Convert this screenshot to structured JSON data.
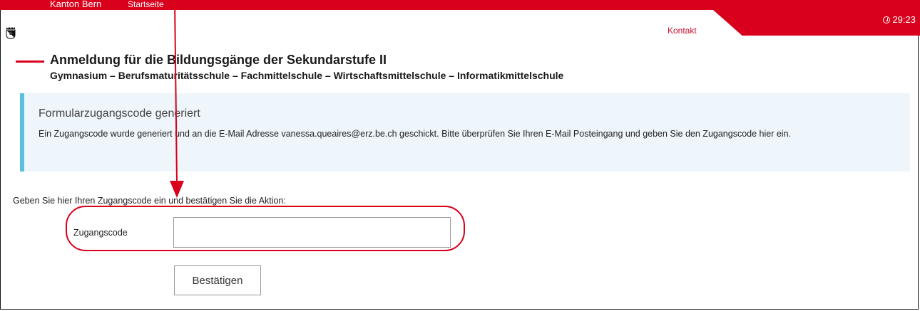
{
  "topbar": {
    "kanton": "Kanton Bern",
    "startseite": "Startseite"
  },
  "timer": "29:23",
  "kontakt": "Kontakt",
  "heading": {
    "title": "Anmeldung für die Bildungsgänge der Sekundarstufe II",
    "subtitle": "Gymnasium – Berufsmaturitätsschule – Fachmittelschule – Wirtschaftsmittelschule – Informatikmittelschule"
  },
  "info": {
    "title": "Formularzugangscode generiert",
    "text": "Ein Zugangscode wurde generiert und an die E-Mail Adresse vanessa.queaires@erz.be.ch geschickt. Bitte überprüfen Sie Ihren E-Mail Posteingang und geben Sie den Zugangscode hier ein."
  },
  "form": {
    "prompt": "Geben Sie hier Ihren Zugangscode ein und bestätigen Sie die Aktion:",
    "code_label": "Zugangscode",
    "code_value": "",
    "submit_label": "Bestätigen"
  },
  "colors": {
    "brand_red": "#d9001b",
    "info_bg": "#eef6fb",
    "info_border": "#5bc0de"
  },
  "icons": {
    "logo": "bern-bear-coat-of-arms-icon",
    "timer": "clock-icon"
  }
}
